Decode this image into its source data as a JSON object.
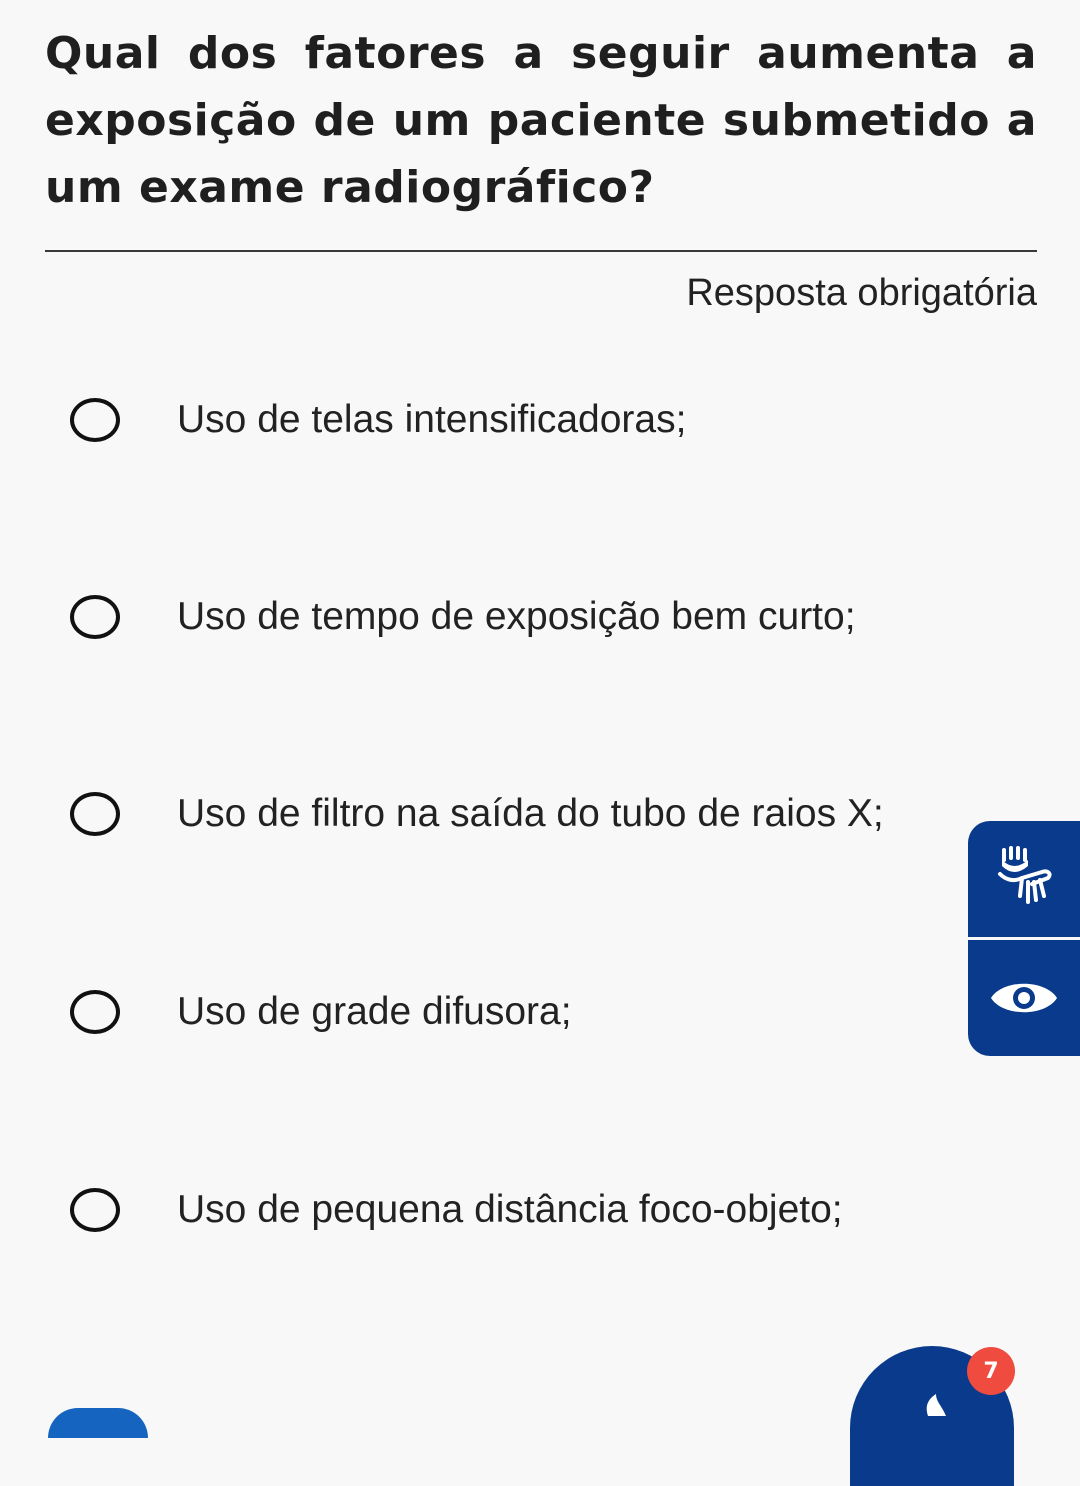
{
  "question": {
    "title": "Qual dos fatores a seguir aumenta a exposição de um paciente submetido a um exame radiográfico?",
    "required_label": "Resposta obrigatória"
  },
  "options": [
    {
      "label": "Uso de telas intensificadoras;",
      "selected": false
    },
    {
      "label": "Uso de tempo de exposição bem curto;",
      "selected": false
    },
    {
      "label": "Uso de filtro na saída do tubo de raios X;",
      "selected": false
    },
    {
      "label": "Uso de grade difusora;",
      "selected": false
    },
    {
      "label": "Uso de pequena distância foco-objeto;",
      "selected": false
    }
  ],
  "accessibility": {
    "buttons": [
      {
        "icon": "sign-language-hand-icon"
      },
      {
        "icon": "eye-icon"
      }
    ]
  },
  "notification": {
    "badge_count": "7",
    "badge_color": "#ef4b3f",
    "accent_color": "#0a3a8c"
  }
}
